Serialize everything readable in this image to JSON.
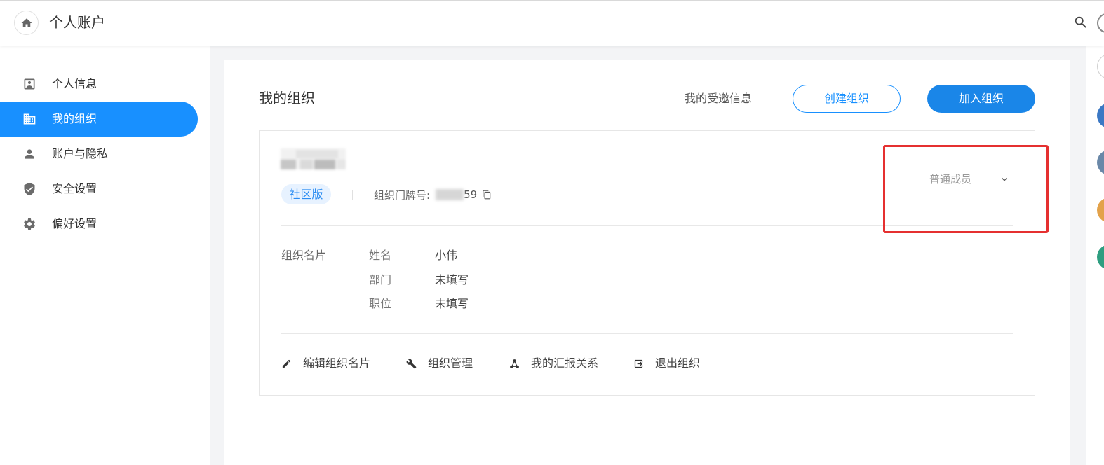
{
  "header": {
    "title": "个人账户",
    "home_icon": "home-icon",
    "search_icon": "search-icon"
  },
  "sidebar": {
    "items": [
      {
        "label": "个人信息",
        "icon": "contact-card-icon",
        "active": false
      },
      {
        "label": "我的组织",
        "icon": "building-icon",
        "active": true
      },
      {
        "label": "账户与隐私",
        "icon": "person-icon",
        "active": false
      },
      {
        "label": "安全设置",
        "icon": "shield-icon",
        "active": false
      },
      {
        "label": "偏好设置",
        "icon": "gear-icon",
        "active": false
      }
    ]
  },
  "main": {
    "title": "我的组织",
    "invitations_link": "我的受邀信息",
    "create_org_button": "创建组织",
    "join_org_button": "加入组织",
    "org": {
      "edition_badge": "社区版",
      "door_number_label": "组织门牌号:",
      "door_number_visible": "59",
      "copy_icon": "copy-icon",
      "role": "普通成员",
      "role_icon": "chevron-down-icon",
      "card_label": "组织名片",
      "fields": [
        {
          "label": "姓名",
          "value": "小伟"
        },
        {
          "label": "部门",
          "value": "未填写"
        },
        {
          "label": "职位",
          "value": "未填写"
        }
      ],
      "actions": [
        {
          "label": "编辑组织名片",
          "icon": "pencil-icon"
        },
        {
          "label": "组织管理",
          "icon": "wrench-icon"
        },
        {
          "label": "我的汇报关系",
          "icon": "hierarchy-icon"
        },
        {
          "label": "退出组织",
          "icon": "exit-icon"
        }
      ]
    }
  },
  "right_rail": {
    "avatars": [
      {
        "fill": "#ffffff",
        "outline": "#cfcfcf"
      },
      {
        "fill": "#3b78c4"
      },
      {
        "fill": "#6a88a8"
      },
      {
        "fill": "#e3a24a"
      },
      {
        "fill": "#2e9e80"
      }
    ]
  },
  "colors": {
    "accent": "#1890ff",
    "primary_button": "#1a86e8",
    "annotation": "#e53030",
    "page_bg": "#f3f4f6"
  }
}
